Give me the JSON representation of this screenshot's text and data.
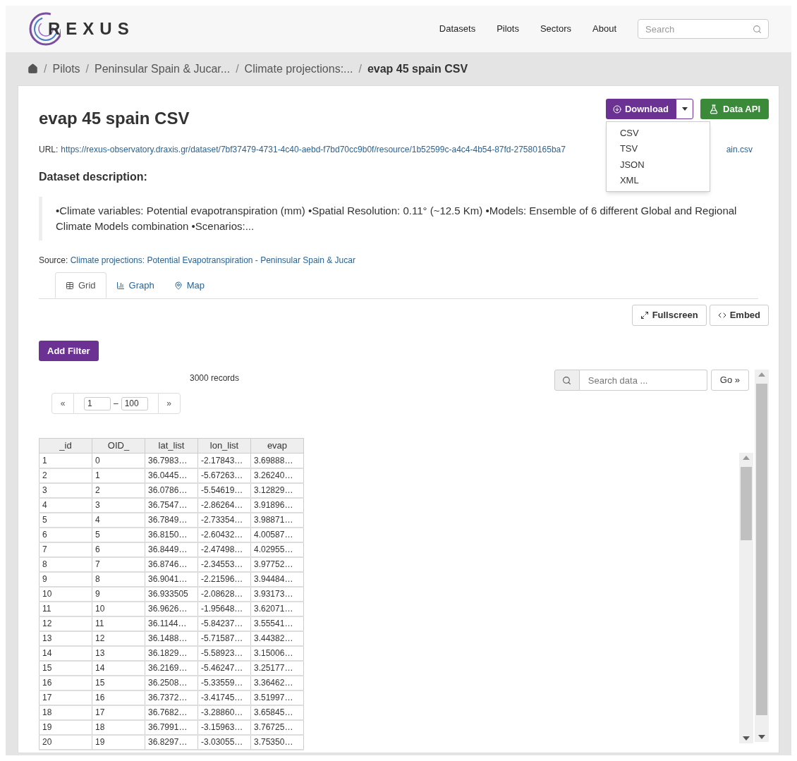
{
  "logo": {
    "text": "REXUS"
  },
  "nav": {
    "links": [
      "Datasets",
      "Pilots",
      "Sectors",
      "About"
    ],
    "search": {
      "placeholder": "Search"
    }
  },
  "breadcrumb_separator": "/",
  "breadcrumb": [
    "Pilots",
    "Peninsular Spain & Jucar...",
    "Climate projections:...",
    "evap 45 spain CSV"
  ],
  "title": "evap 45 spain CSV",
  "actions": {
    "download": "Download",
    "data_api": "Data API",
    "dropdown_open": true,
    "formats": [
      "CSV",
      "TSV",
      "JSON",
      "XML"
    ]
  },
  "url": {
    "label": "URL:",
    "start": "https://rexus-observatory.draxis.gr/dataset/7bf37479-4731-4c40-aebd-f7bd70cc9b0f/resource/1b52599c-a4c4-4b54-87fd-27580165ba7",
    "end": "ain.csv"
  },
  "description": {
    "heading": "Dataset description:",
    "text": "•Climate variables: Potential evapotranspiration (mm) •Spatial Resolution: 0.11° (~12.5 Km) •Models: Ensemble of 6 different Global and Regional Climate Models combination •Scenarios:..."
  },
  "source": {
    "label": "Source:",
    "link": "Climate projections: Potential Evapotranspiration - Peninsular Spain & Jucar"
  },
  "tabs": [
    {
      "kind": "grid",
      "label": "Grid",
      "selected": true
    },
    {
      "kind": "graph",
      "label": "Graph",
      "selected": false
    },
    {
      "kind": "map",
      "label": "Map",
      "selected": false
    }
  ],
  "view_buttons": [
    {
      "kind": "fullscreen",
      "label": "Fullscreen"
    },
    {
      "kind": "embed",
      "label": "Embed"
    }
  ],
  "add_filter": "Add Filter",
  "records": "3000 records",
  "search_data": {
    "placeholder": "Search data ...",
    "go": "Go »"
  },
  "pager": {
    "prev": "«",
    "from": "1",
    "sep": "–",
    "to": "100",
    "next": "»"
  },
  "table": {
    "columns": [
      "_id",
      "OID_",
      "lat_list",
      "lon_list",
      "evap"
    ],
    "rows": [
      [
        "1",
        "0",
        "36.7983…",
        "-2.17843…",
        "3.69888…"
      ],
      [
        "2",
        "1",
        "36.0445…",
        "-5.67263…",
        "3.26240…"
      ],
      [
        "3",
        "2",
        "36.0786…",
        "-5.54619…",
        "3.12829…"
      ],
      [
        "4",
        "3",
        "36.7547…",
        "-2.86264…",
        "3.91896…"
      ],
      [
        "5",
        "4",
        "36.7849…",
        "-2.73354…",
        "3.98871…"
      ],
      [
        "6",
        "5",
        "36.8150…",
        "-2.60432…",
        "4.00587…"
      ],
      [
        "7",
        "6",
        "36.8449…",
        "-2.47498…",
        "4.02955…"
      ],
      [
        "8",
        "7",
        "36.8746…",
        "-2.34553…",
        "3.97752…"
      ],
      [
        "9",
        "8",
        "36.9041…",
        "-2.21596…",
        "3.94484…"
      ],
      [
        "10",
        "9",
        "36.933505",
        "-2.08628…",
        "3.93173…"
      ],
      [
        "11",
        "10",
        "36.9626…",
        "-1.95648…",
        "3.62071…"
      ],
      [
        "12",
        "11",
        "36.1144…",
        "-5.84237…",
        "3.55541…"
      ],
      [
        "13",
        "12",
        "36.1488…",
        "-5.71587…",
        "3.44382…"
      ],
      [
        "14",
        "13",
        "36.1829…",
        "-5.58923…",
        "3.15006…"
      ],
      [
        "15",
        "14",
        "36.2169…",
        "-5.46247…",
        "3.25177…"
      ],
      [
        "16",
        "15",
        "36.2508…",
        "-5.33559…",
        "3.36462…"
      ],
      [
        "17",
        "16",
        "36.7372…",
        "-3.41745…",
        "3.51997…"
      ],
      [
        "18",
        "17",
        "36.7682…",
        "-3.28860…",
        "3.65845…"
      ],
      [
        "19",
        "18",
        "36.7991…",
        "-3.15963…",
        "3.76725…"
      ],
      [
        "20",
        "19",
        "36.8297…",
        "-3.03055…",
        "3.75350…"
      ]
    ]
  }
}
